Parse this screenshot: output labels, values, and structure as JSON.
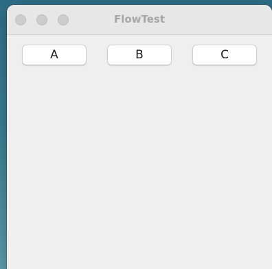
{
  "window": {
    "title": "FlowTest"
  },
  "buttons": {
    "a_label": "A",
    "b_label": "B",
    "c_label": "C"
  },
  "colors": {
    "titlebar": "#e7e7e7",
    "window_bg": "#efefef",
    "title_text": "#a7a7a7",
    "traffic_light_inactive": "#cdcdcd",
    "button_bg": "#ffffff"
  }
}
